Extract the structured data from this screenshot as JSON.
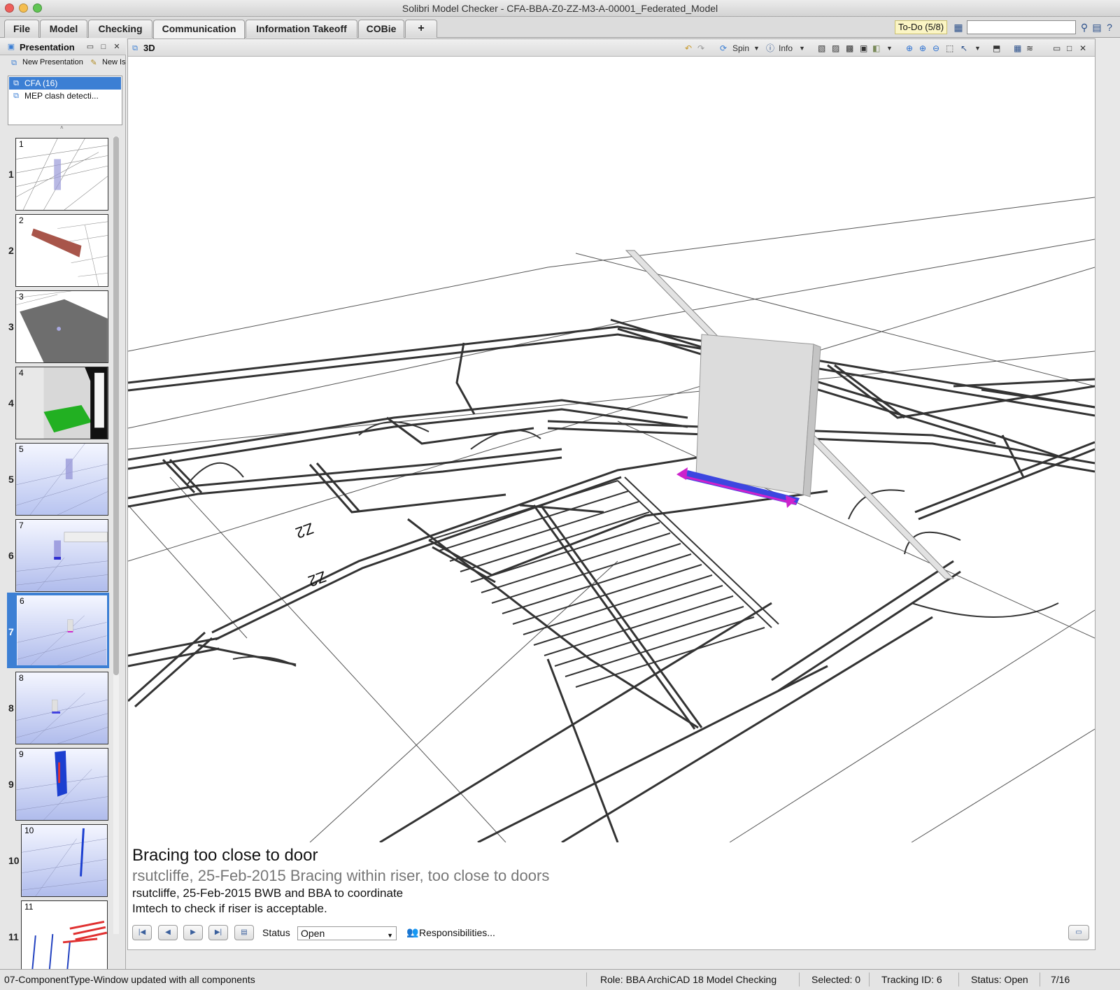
{
  "window": {
    "title": "Solibri Model Checker - CFA-BBA-Z0-ZZ-M3-A-00001_Federated_Model"
  },
  "tabs": [
    {
      "label": "File"
    },
    {
      "label": "Model"
    },
    {
      "label": "Checking"
    },
    {
      "label": "Communication",
      "active": true
    },
    {
      "label": "Information Takeoff"
    },
    {
      "label": "COBie"
    },
    {
      "label": "+"
    }
  ],
  "todo": {
    "label": "To-Do (5/8)"
  },
  "search": {
    "value": ""
  },
  "presentation": {
    "title": "Presentation",
    "new_presentation": "New Presentation",
    "new_issue": "New Is",
    "list": [
      {
        "label": "CFA (16)",
        "selected": true
      },
      {
        "label": "MEP clash detecti..."
      }
    ],
    "slides": [
      {
        "num": "1",
        "index": "1"
      },
      {
        "num": "2",
        "index": "2"
      },
      {
        "num": "3",
        "index": "3"
      },
      {
        "num": "4",
        "index": "4"
      },
      {
        "num": "5",
        "index": "5"
      },
      {
        "num": "7",
        "index": "6"
      },
      {
        "num": "6",
        "index": "7",
        "selected": true
      },
      {
        "num": "8",
        "index": "8"
      },
      {
        "num": "9",
        "index": "9"
      },
      {
        "num": "10",
        "index": "10"
      },
      {
        "num": "11",
        "index": "11"
      }
    ]
  },
  "view3d": {
    "title": "3D",
    "spin": "Spin",
    "info": "Info",
    "floor_labels": [
      "Z2",
      "Z2"
    ]
  },
  "issue": {
    "title": "Bracing too close to door",
    "comment1": "rsutcliffe, 25-Feb-2015 Bracing within riser, too close to doors",
    "comment2": "rsutcliffe, 25-Feb-2015 BWB and BBA to coordinate",
    "comment3": "Imtech to check if riser is acceptable.",
    "status_label": "Status",
    "status_value": "Open",
    "responsibilities": "Responsibilities..."
  },
  "statusbar": {
    "message": "07-ComponentType-Window updated with all components",
    "role": "Role: BBA ArchiCAD 18 Model Checking",
    "selected": "Selected: 0",
    "tracking": "Tracking ID: 6",
    "status": "Status: Open",
    "page": "7/16"
  },
  "colors": {
    "accent": "#3c7fd4",
    "todo_bg": "#fbf5c4",
    "highlight": "#cc22cc"
  }
}
